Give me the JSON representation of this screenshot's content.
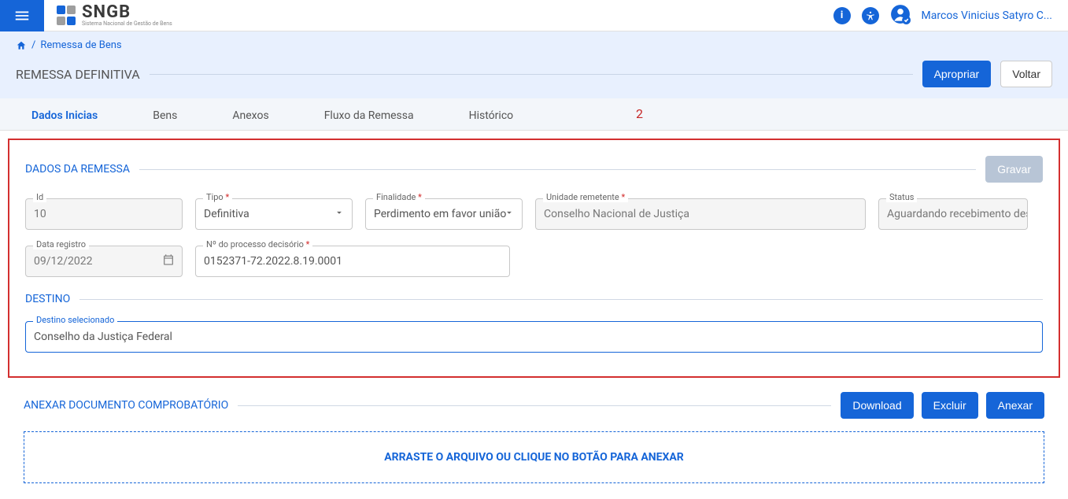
{
  "header": {
    "logo_name": "SNGB",
    "logo_sub": "Sistema Nacional de Gestão de Bens",
    "user_name": "Marcos Vinicius Satyro C..."
  },
  "breadcrumb": {
    "item": "Remessa de Bens"
  },
  "page": {
    "title": "REMESSA DEFINITIVA",
    "btn_apropriar": "Apropriar",
    "btn_voltar": "Voltar"
  },
  "tabs": {
    "dados": "Dados Inicias",
    "bens": "Bens",
    "anexos": "Anexos",
    "fluxo": "Fluxo da Remessa",
    "historico": "Histórico"
  },
  "annotation": "2",
  "dados_remessa": {
    "section_title": "DADOS DA REMESSA",
    "btn_gravar": "Gravar",
    "id_label": "Id",
    "id_value": "10",
    "tipo_label": "Tipo",
    "tipo_value": "Definitiva",
    "finalidade_label": "Finalidade",
    "finalidade_value": "Perdimento em favor união",
    "unidade_label": "Unidade remetente",
    "unidade_value": "Conselho Nacional de Justiça",
    "status_label": "Status",
    "status_value": "Aguardando recebimento destina",
    "data_label": "Data registro",
    "data_value": "09/12/2022",
    "processo_label": "Nº do processo decisório",
    "processo_value": "0152371-72.2022.8.19.0001"
  },
  "destino": {
    "section_title": "DESTINO",
    "label": "Destino selecionado",
    "value": "Conselho da Justiça Federal"
  },
  "anexar": {
    "section_title": "ANEXAR DOCUMENTO COMPROBATÓRIO",
    "btn_download": "Download",
    "btn_excluir": "Excluir",
    "btn_anexar": "Anexar",
    "dropzone": "ARRASTE O ARQUIVO OU CLIQUE NO BOTÃO PARA ANEXAR"
  }
}
